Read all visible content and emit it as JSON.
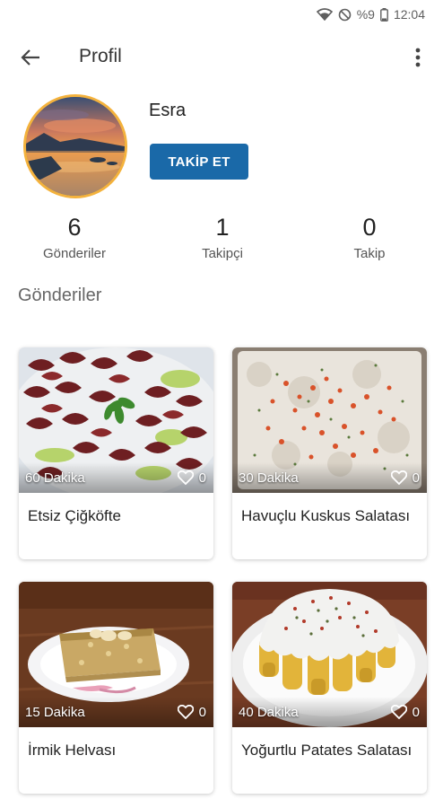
{
  "status_bar": {
    "battery_text": "%9",
    "time": "12:04"
  },
  "app_bar": {
    "title": "Profil"
  },
  "profile": {
    "name": "Esra",
    "follow_label": "TAKİP ET"
  },
  "stats": {
    "posts": {
      "value": "6",
      "label": "Gönderiler"
    },
    "followers": {
      "value": "1",
      "label": "Takipçi"
    },
    "following": {
      "value": "0",
      "label": "Takip"
    }
  },
  "section": {
    "title": "Gönderiler"
  },
  "posts": [
    {
      "title": "Etsiz Çiğköfte",
      "duration": "60 Dakika",
      "likes": "0"
    },
    {
      "title": "Havuçlu Kuskus Salatası",
      "duration": "30 Dakika",
      "likes": "0"
    },
    {
      "title": "İrmik Helvası",
      "duration": "15 Dakika",
      "likes": "0"
    },
    {
      "title": "Yoğurtlu Patates Salatası",
      "duration": "40 Dakika",
      "likes": "0"
    }
  ],
  "colors": {
    "accent": "#1a69a8",
    "avatar_ring": "#f4b23c"
  }
}
